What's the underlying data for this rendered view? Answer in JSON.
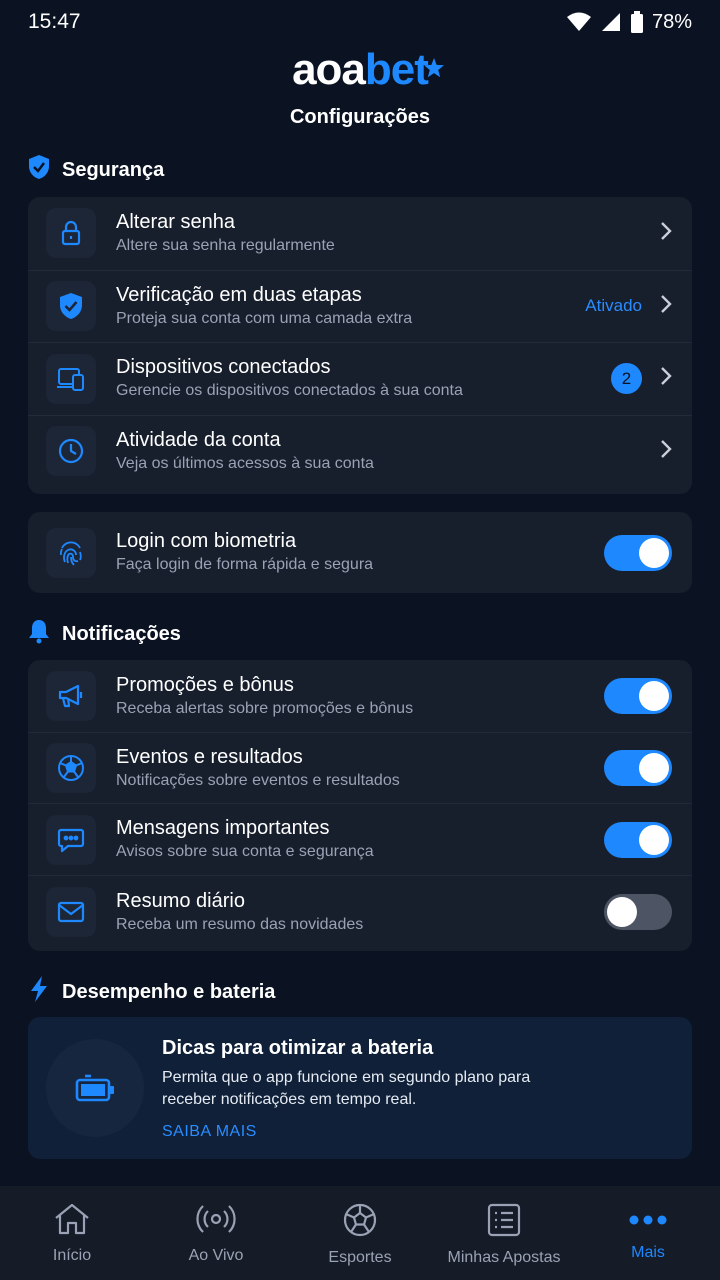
{
  "status_bar": {
    "time": "15:47",
    "battery": "78%"
  },
  "brand": {
    "logo_part1": "aoa",
    "logo_part2": "bet"
  },
  "header": {
    "title": "Configurações"
  },
  "colors": {
    "accent": "#1e88ff",
    "background": "#0b1322",
    "card": "#171e2c"
  },
  "security": {
    "title": "Segurança",
    "icon": "shield-check-icon",
    "items": [
      {
        "title": "Alterar senha",
        "subtitle": "Altere sua senha regularmente",
        "icon": "lock-icon"
      },
      {
        "title": "Verificação em duas etapas",
        "subtitle": "Proteja sua conta com uma camada extra",
        "status": "Ativado",
        "icon": "shield-check-icon"
      },
      {
        "title": "Dispositivos conectados",
        "subtitle": "Gerencie os dispositivos conectados à sua conta",
        "badge": "2",
        "icon": "devices-icon"
      },
      {
        "title": "Atividade da conta",
        "subtitle": "Veja os últimos acessos à sua conta",
        "icon": "clock-icon"
      }
    ]
  },
  "biometric": {
    "title": "Login com biometria",
    "subtitle": "Faça login de forma rápida e segura",
    "enabled": true,
    "icon": "fingerprint-icon"
  },
  "notifications": {
    "title": "Notificações",
    "icon": "bell-icon",
    "items": [
      {
        "title": "Promoções e bônus",
        "subtitle": "Receba alertas sobre promoções e bônus",
        "enabled": true,
        "icon": "megaphone-icon"
      },
      {
        "title": "Eventos e resultados",
        "subtitle": "Notificações sobre eventos e resultados",
        "enabled": true,
        "icon": "soccer-ball-icon"
      },
      {
        "title": "Mensagens importantes",
        "subtitle": "Avisos sobre sua conta e segurança",
        "enabled": true,
        "icon": "chat-icon"
      },
      {
        "title": "Resumo diário",
        "subtitle": "Receba um resumo das novidades",
        "enabled": false,
        "icon": "mail-icon"
      }
    ]
  },
  "performance": {
    "title": "Desempenho e bateria",
    "icon": "lightning-icon",
    "tip_title": "Dicas para otimizar a bateria",
    "tip_body": "Permita que o app funcione em segundo plano para receber notificações em tempo real.",
    "tip_link": "SAIBA MAIS",
    "tip_icon": "battery-icon"
  },
  "bottom_nav": [
    {
      "label": "Início",
      "icon": "home-icon",
      "active": false
    },
    {
      "label": "Ao Vivo",
      "icon": "live-broadcast-icon",
      "active": false
    },
    {
      "label": "Esportes",
      "icon": "soccer-ball-icon",
      "active": false
    },
    {
      "label": "Minhas Apostas",
      "icon": "bet-slip-icon",
      "active": false
    },
    {
      "label": "Mais",
      "icon": "more-dots-icon",
      "active": true
    }
  ]
}
